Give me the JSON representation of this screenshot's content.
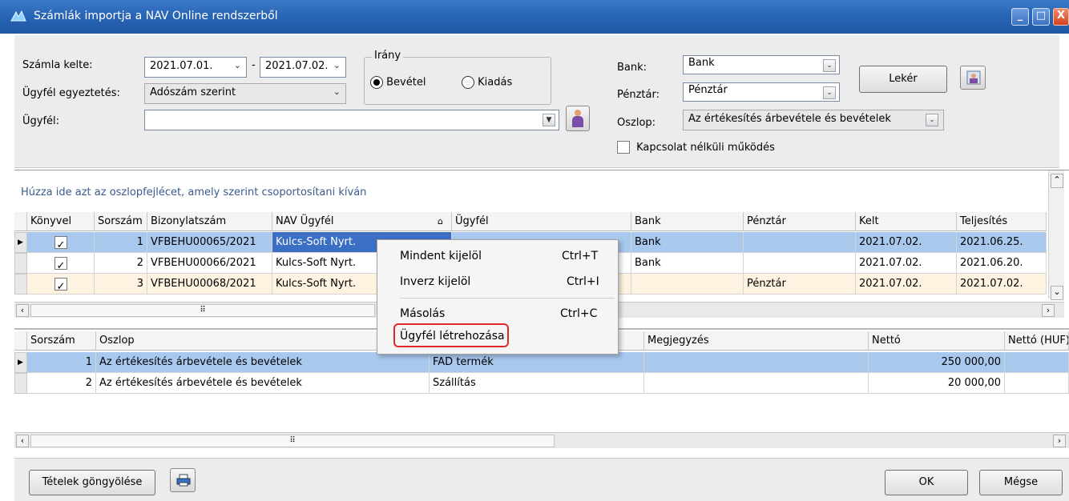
{
  "window": {
    "title": "Számlák importja a NAV Online rendszerből",
    "buttons": {
      "minimize": "_",
      "maximize": "□",
      "close": "X"
    }
  },
  "filters": {
    "szamla_kelte_label": "Számla kelte:",
    "date_from": "2021.07.01.",
    "date_sep": "-",
    "date_to": "2021.07.02.",
    "ugyfel_egyeztetes_label": "Ügyfél egyeztetés:",
    "ugyfel_egyeztetes_value": "Adószám szerint",
    "ugyfel_label": "Ügyfél:",
    "ugyfel_value": "",
    "irany_label": "Irány",
    "radio_bevetel": "Bevétel",
    "radio_kiadas": "Kiadás",
    "radio_selected": "Bevétel",
    "bank_label": "Bank:",
    "bank_value": "Bank",
    "penztar_label": "Pénztár:",
    "penztar_value": "Pénztár",
    "oszlop_label": "Oszlop:",
    "oszlop_value": "Az értékesítés árbevétele és bevételek",
    "offline_label": "Kapcsolat nélküli működés",
    "offline_checked": false,
    "leker_button": "Lekér"
  },
  "grid1": {
    "group_hint": "Húzza ide azt az oszlopfejlécet, amely szerint csoportosítani kíván",
    "columns": [
      "Könyvel",
      "Sorszám",
      "Bizonylatszám",
      "NAV Ügyfél",
      "Ügyfél",
      "Bank",
      "Pénztár",
      "Kelt",
      "Teljesítés"
    ],
    "rows": [
      {
        "konyvel": true,
        "sorszam": "1",
        "bizonylat": "VFBEHU00065/2021",
        "nav_ugyfel": "Kulcs-Soft Nyrt.",
        "ugyfel": "",
        "bank": "Bank",
        "penztar": "",
        "kelt": "2021.07.02.",
        "teljesites": "2021.06.25."
      },
      {
        "konyvel": true,
        "sorszam": "2",
        "bizonylat": "VFBEHU00066/2021",
        "nav_ugyfel": "Kulcs-Soft Nyrt.",
        "ugyfel": "",
        "bank": "Bank",
        "penztar": "",
        "kelt": "2021.07.02.",
        "teljesites": "2021.06.20."
      },
      {
        "konyvel": true,
        "sorszam": "3",
        "bizonylat": "VFBEHU00068/2021",
        "nav_ugyfel": "Kulcs-Soft Nyrt.",
        "ugyfel": "",
        "bank": "",
        "penztar": "Pénztár",
        "kelt": "2021.07.02.",
        "teljesites": "2021.07.02."
      }
    ]
  },
  "grid2": {
    "columns": [
      "Sorszám",
      "Oszlop",
      "",
      "Megjegyzés",
      "Nettó",
      "Nettó (HUF)"
    ],
    "rows": [
      {
        "sorszam": "1",
        "oszlop": "Az értékesítés árbevétele és bevételek",
        "megnevezes": "FAD termék",
        "megjegyzes": "",
        "netto": "250 000,00"
      },
      {
        "sorszam": "2",
        "oszlop": "Az értékesítés árbevétele és bevételek",
        "megnevezes": "Szállítás",
        "megjegyzes": "",
        "netto": "20 000,00"
      }
    ]
  },
  "context_menu": {
    "items": [
      {
        "label": "Mindent kijelöl",
        "shortcut": "Ctrl+T"
      },
      {
        "label": "Inverz kijelöl",
        "shortcut": "Ctrl+I"
      },
      {
        "label": "Másolás",
        "shortcut": "Ctrl+C"
      },
      {
        "label": "Ügyfél létrehozása",
        "shortcut": ""
      }
    ],
    "highlighted_item": "Ügyfél létrehozása"
  },
  "footer": {
    "tetelek_button": "Tételek göngyölése",
    "ok_button": "OK",
    "megse_button": "Mégse"
  },
  "colors": {
    "title_bar": "#2864b4",
    "selected_row": "#a8c8ee",
    "highlight_ring": "#e0282c"
  }
}
